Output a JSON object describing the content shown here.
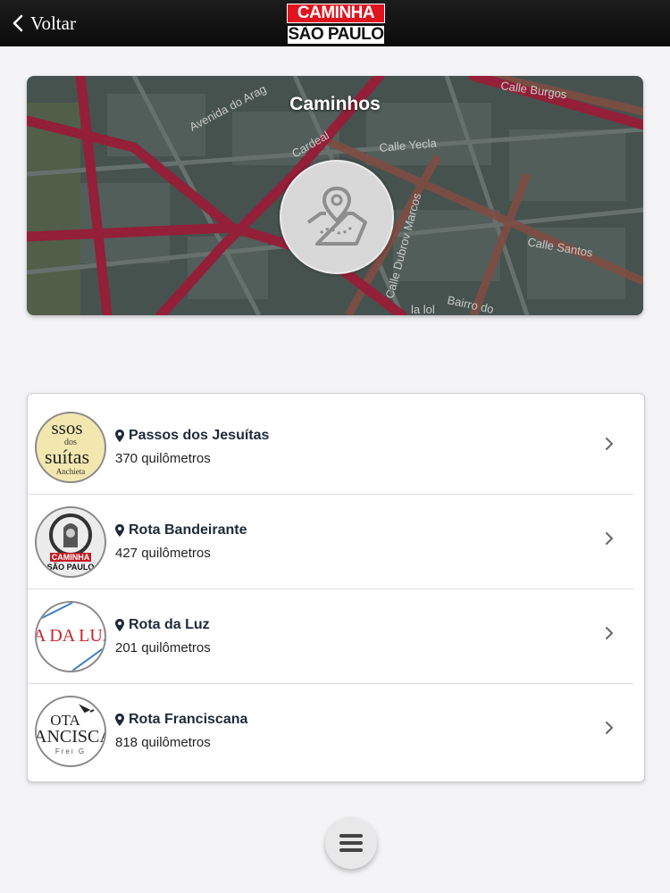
{
  "header": {
    "back_label": "Voltar",
    "logo_line1": "CAMINHA",
    "logo_line2": "SÃO PAULO",
    "back_icon": "chevron-left-icon"
  },
  "hero": {
    "title": "Caminhos",
    "map_labels": [
      "Avenida do Arag",
      "Calle Yecla",
      "Cardeal",
      "Bairro do",
      "Calle Santos",
      "Calle Burgos",
      "Calle Dubrov Marcos",
      "la lol"
    ],
    "badge_icon": "map-pin-icon"
  },
  "routes": [
    {
      "name": "Passos dos Jesuítas",
      "distance": "370 quilômetros",
      "thumb_lines": [
        "ssos",
        "dos",
        "suítas",
        "Anchieta"
      ]
    },
    {
      "name": "Rota Bandeirante",
      "distance": "427 quilômetros",
      "thumb_lines": [
        "CAMINHA",
        "SÃO PAULO"
      ]
    },
    {
      "name": "Rota da Luz",
      "distance": "201 quilômetros",
      "thumb_lines": [
        "A DA LUZ"
      ]
    },
    {
      "name": "Rota Franciscana",
      "distance": "818 quilômetros",
      "thumb_lines": [
        "OTA",
        "ANCISCA",
        "Frei G"
      ]
    }
  ],
  "menu": {
    "icon": "hamburger-menu-icon"
  },
  "colors": {
    "topbar": "#111111",
    "logo_red": "#e0141f",
    "title": "#1e2a3a",
    "route_red": "#a0223e"
  }
}
